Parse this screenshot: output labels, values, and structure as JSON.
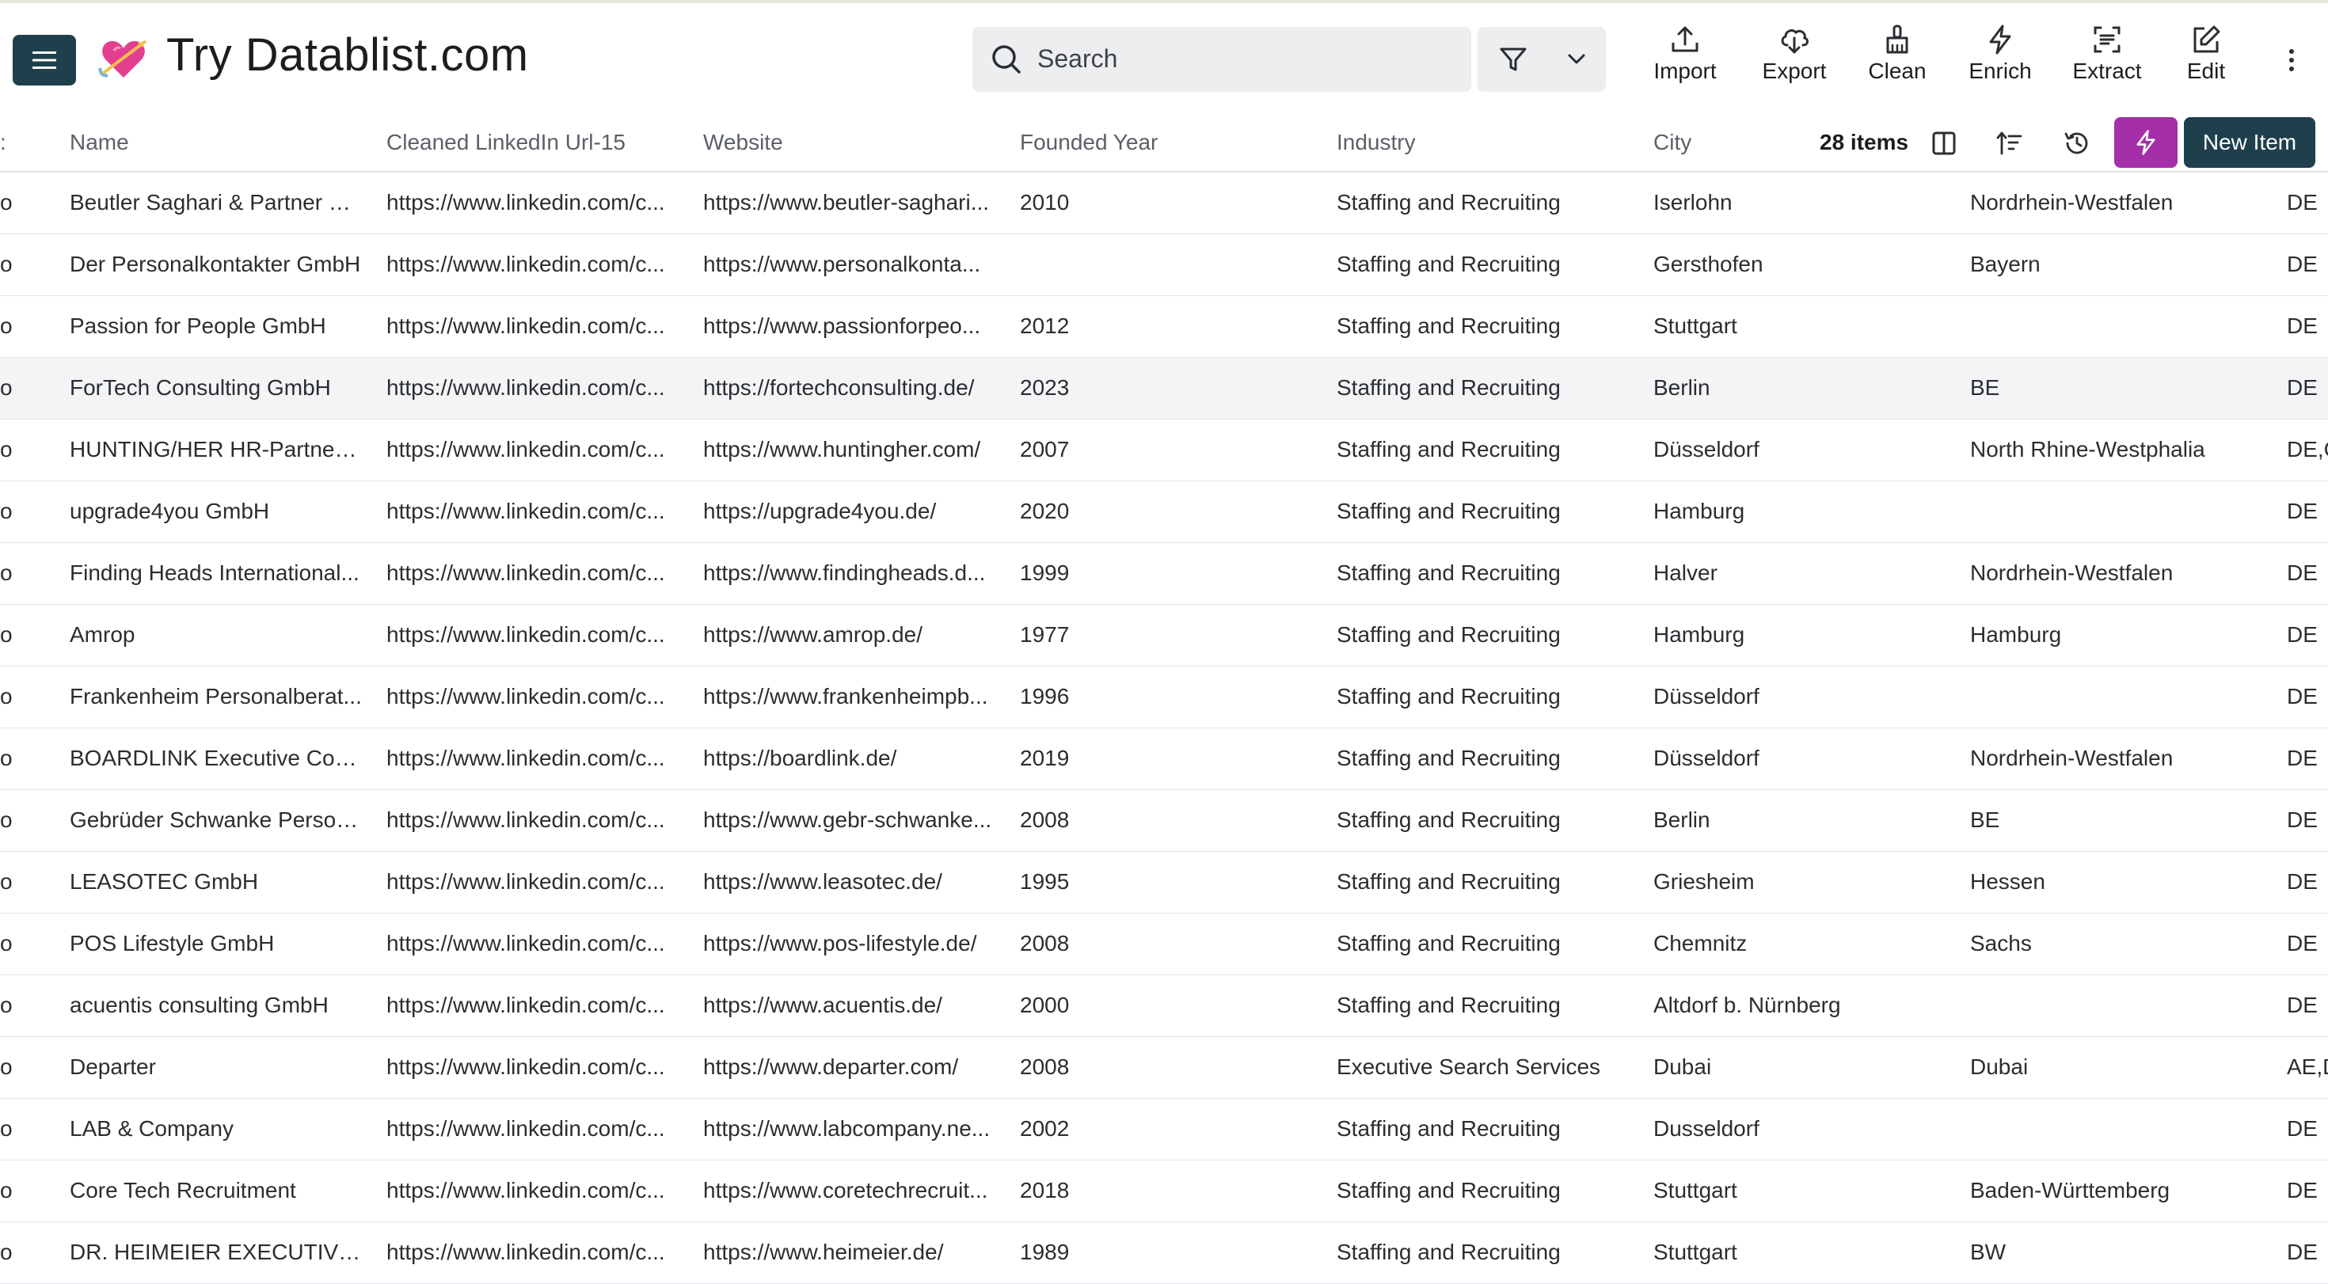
{
  "app": {
    "title": "Try Datablist.com",
    "logo": "heart-arrow-emoji"
  },
  "search": {
    "placeholder": "Search"
  },
  "toolbar": {
    "import_label": "Import",
    "export_label": "Export",
    "clean_label": "Clean",
    "enrich_label": "Enrich",
    "extract_label": "Extract",
    "edit_label": "Edit"
  },
  "table": {
    "stub_header": ":",
    "columns": [
      "Name",
      "Cleaned LinkedIn Url-15",
      "Website",
      "Founded Year",
      "Industry",
      "City"
    ],
    "items_count": "28 items",
    "new_item_label": "New Item",
    "rows": [
      {
        "stub": "o",
        "name": "Beutler Saghari & Partner G...",
        "linkedin": "https://www.linkedin.com/c...",
        "website": "https://www.beutler-saghari...",
        "year": "2010",
        "industry": "Staffing and Recruiting",
        "city": "Iserlohn",
        "region": "Nordrhein-Westfalen",
        "country": "DE"
      },
      {
        "stub": "o",
        "name": "Der Personalkontakter GmbH",
        "linkedin": "https://www.linkedin.com/c...",
        "website": "https://www.personalkonta...",
        "year": "",
        "industry": "Staffing and Recruiting",
        "city": "Gersthofen",
        "region": "Bayern",
        "country": "DE"
      },
      {
        "stub": "o",
        "name": "Passion for People GmbH",
        "linkedin": "https://www.linkedin.com/c...",
        "website": "https://www.passionforpeo...",
        "year": "2012",
        "industry": "Staffing and Recruiting",
        "city": "Stuttgart",
        "region": "",
        "country": "DE"
      },
      {
        "stub": "o",
        "name": "ForTech Consulting GmbH",
        "linkedin": "https://www.linkedin.com/c...",
        "website": "https://fortechconsulting.de/",
        "year": "2023",
        "industry": "Staffing and Recruiting",
        "city": "Berlin",
        "region": "BE",
        "country": "DE"
      },
      {
        "stub": "o",
        "name": "HUNTING/HER HR-Partners...",
        "linkedin": "https://www.linkedin.com/c...",
        "website": "https://www.huntingher.com/",
        "year": "2007",
        "industry": "Staffing and Recruiting",
        "city": "Düsseldorf",
        "region": "North Rhine-Westphalia",
        "country": "DE,C"
      },
      {
        "stub": "o",
        "name": "upgrade4you GmbH",
        "linkedin": "https://www.linkedin.com/c...",
        "website": "https://upgrade4you.de/",
        "year": "2020",
        "industry": "Staffing and Recruiting",
        "city": "Hamburg",
        "region": "",
        "country": "DE"
      },
      {
        "stub": "o",
        "name": "Finding Heads International...",
        "linkedin": "https://www.linkedin.com/c...",
        "website": "https://www.findingheads.d...",
        "year": "1999",
        "industry": "Staffing and Recruiting",
        "city": "Halver",
        "region": "Nordrhein-Westfalen",
        "country": "DE"
      },
      {
        "stub": "o",
        "name": "Amrop",
        "linkedin": "https://www.linkedin.com/c...",
        "website": "https://www.amrop.de/",
        "year": "1977",
        "industry": "Staffing and Recruiting",
        "city": "Hamburg",
        "region": "Hamburg",
        "country": "DE"
      },
      {
        "stub": "o",
        "name": "Frankenheim Personalberat...",
        "linkedin": "https://www.linkedin.com/c...",
        "website": "https://www.frankenheimpb...",
        "year": "1996",
        "industry": "Staffing and Recruiting",
        "city": "Düsseldorf",
        "region": "",
        "country": "DE"
      },
      {
        "stub": "o",
        "name": "BOARDLINK Executive Cons...",
        "linkedin": "https://www.linkedin.com/c...",
        "website": "https://boardlink.de/",
        "year": "2019",
        "industry": "Staffing and Recruiting",
        "city": "Düsseldorf",
        "region": "Nordrhein-Westfalen",
        "country": "DE"
      },
      {
        "stub": "o",
        "name": "Gebrüder Schwanke Person...",
        "linkedin": "https://www.linkedin.com/c...",
        "website": "https://www.gebr-schwanke...",
        "year": "2008",
        "industry": "Staffing and Recruiting",
        "city": "Berlin",
        "region": "BE",
        "country": "DE"
      },
      {
        "stub": "o",
        "name": "LEASOTEC GmbH",
        "linkedin": "https://www.linkedin.com/c...",
        "website": "https://www.leasotec.de/",
        "year": "1995",
        "industry": "Staffing and Recruiting",
        "city": "Griesheim",
        "region": "Hessen",
        "country": "DE"
      },
      {
        "stub": "o",
        "name": "POS Lifestyle GmbH",
        "linkedin": "https://www.linkedin.com/c...",
        "website": "https://www.pos-lifestyle.de/",
        "year": "2008",
        "industry": "Staffing and Recruiting",
        "city": "Chemnitz",
        "region": "Sachs",
        "country": "DE"
      },
      {
        "stub": "o",
        "name": "acuentis consulting GmbH",
        "linkedin": "https://www.linkedin.com/c...",
        "website": "https://www.acuentis.de/",
        "year": "2000",
        "industry": "Staffing and Recruiting",
        "city": "Altdorf b. Nürnberg",
        "region": "",
        "country": "DE"
      },
      {
        "stub": "o",
        "name": "Departer",
        "linkedin": "https://www.linkedin.com/c...",
        "website": "https://www.departer.com/",
        "year": "2008",
        "industry": "Executive Search Services",
        "city": "Dubai",
        "region": "Dubai",
        "country": "AE,D"
      },
      {
        "stub": "o",
        "name": "LAB & Company",
        "linkedin": "https://www.linkedin.com/c...",
        "website": "https://www.labcompany.ne...",
        "year": "2002",
        "industry": "Staffing and Recruiting",
        "city": "Dusseldorf",
        "region": "",
        "country": "DE"
      },
      {
        "stub": "o",
        "name": "Core Tech Recruitment",
        "linkedin": "https://www.linkedin.com/c...",
        "website": "https://www.coretechrecruit...",
        "year": "2018",
        "industry": "Staffing and Recruiting",
        "city": "Stuttgart",
        "region": "Baden-Württemberg",
        "country": "DE"
      },
      {
        "stub": "o",
        "name": "DR. HEIMEIER EXECUTIVE S...",
        "linkedin": "https://www.linkedin.com/c...",
        "website": "https://www.heimeier.de/",
        "year": "1989",
        "industry": "Staffing and Recruiting",
        "city": "Stuttgart",
        "region": "BW",
        "country": "DE"
      }
    ]
  },
  "colors": {
    "primary": "#1f3f4c",
    "magic": "#a52ea9",
    "search_bg": "#eceeef",
    "highlight_row": "#f3f4f5"
  }
}
